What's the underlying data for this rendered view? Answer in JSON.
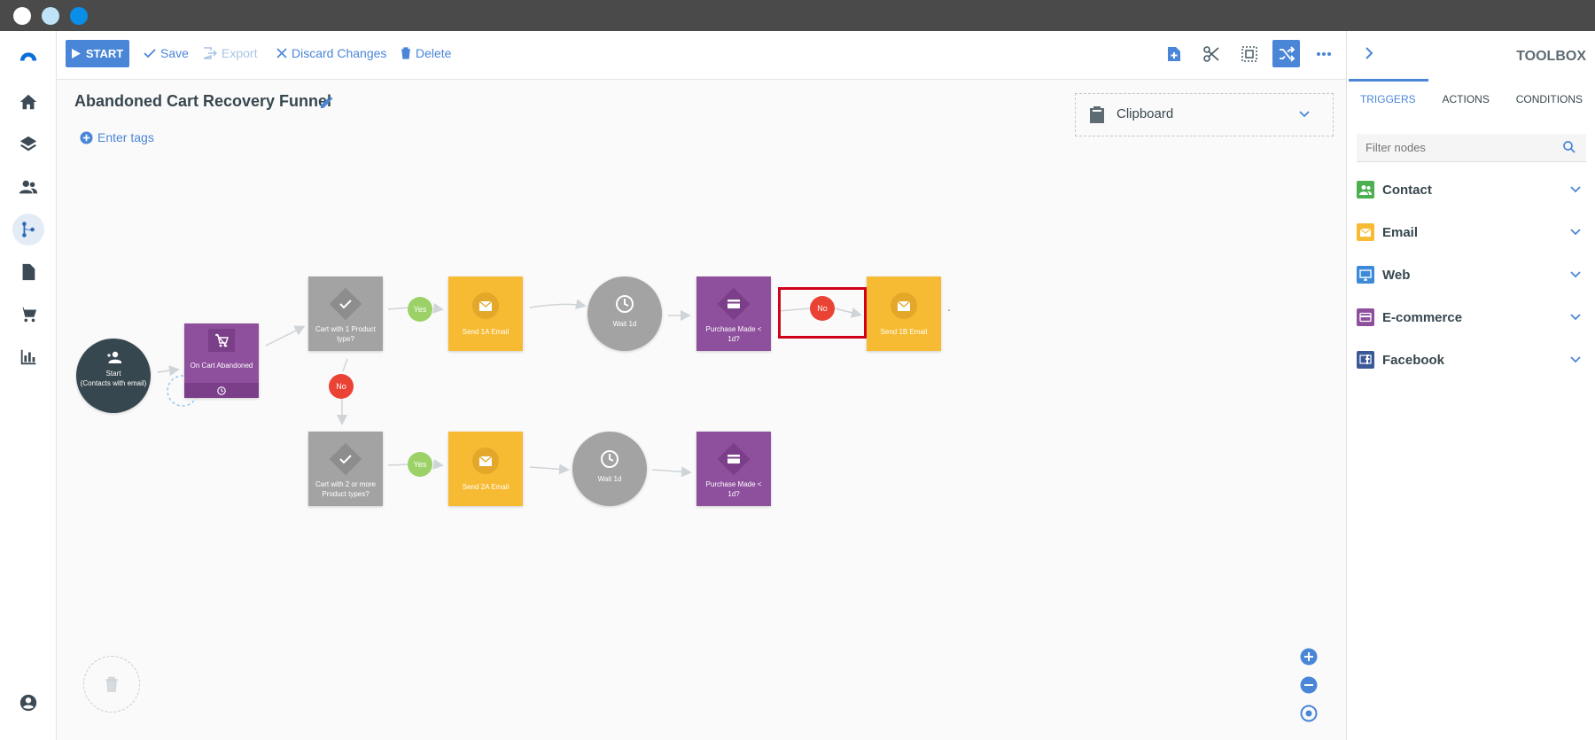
{
  "colors": {
    "accent": "#4a86d8",
    "trigger_purple": "#8e4f9c",
    "email_yellow": "#f6bb33",
    "condition_gray": "#a3a3a3",
    "start_dark": "#37474f",
    "yes_green": "#9bd167",
    "no_red": "#ea4335",
    "highlight_red": "#d0021b"
  },
  "window_dots": [
    "#ffffff",
    "#bfe3f7",
    "#0a8fe8"
  ],
  "nav": {
    "logo": "arc-logo-icon",
    "items": [
      "home-icon",
      "layers-icon",
      "contacts-icon",
      "automation-icon",
      "document-icon",
      "cart-icon",
      "reports-icon"
    ],
    "active": "automation-icon",
    "bottom": "account-icon"
  },
  "toolbar": {
    "start_label": "START",
    "save_label": "Save",
    "export_label": "Export",
    "discard_label": "Discard Changes",
    "delete_label": "Delete"
  },
  "funnel": {
    "title": "Abandoned Cart Recovery Funnel",
    "tags_label": "Enter tags"
  },
  "clipboard": {
    "label": "Clipboard"
  },
  "nodes": {
    "start": "Start\n(Contacts with email)",
    "trigger": "On Cart Abandoned",
    "cond1": "Cart with 1 Product type?",
    "email1a": "Send 1A Email",
    "wait1": "Wait 1d",
    "purchase1": "Purchase Made < 1d?",
    "email1b": "Send 1B Email",
    "cond2": "Cart with 2 or more Product types?",
    "email2a": "Send 2A Email",
    "wait2": "Wait 1d",
    "purchase2": "Purchase Made < 1d?"
  },
  "badges": {
    "yes1": "Yes",
    "no_vertical": "No",
    "no_highlight": "No",
    "yes2": "Yes"
  },
  "toolbox": {
    "title": "TOOLBOX",
    "tabs": [
      "TRIGGERS",
      "ACTIONS",
      "CONDITIONS"
    ],
    "active_tab": "TRIGGERS",
    "filter_placeholder": "Filter nodes",
    "categories": [
      {
        "name": "Contact",
        "color": "#4caf50",
        "icon": "contacts-icon"
      },
      {
        "name": "Email",
        "color": "#f6bb33",
        "icon": "email-icon"
      },
      {
        "name": "Web",
        "color": "#3d8bd8",
        "icon": "monitor-icon"
      },
      {
        "name": "E-commerce",
        "color": "#8e4f9c",
        "icon": "card-icon"
      },
      {
        "name": "Facebook",
        "color": "#3b5998",
        "icon": "facebook-icon"
      }
    ]
  }
}
